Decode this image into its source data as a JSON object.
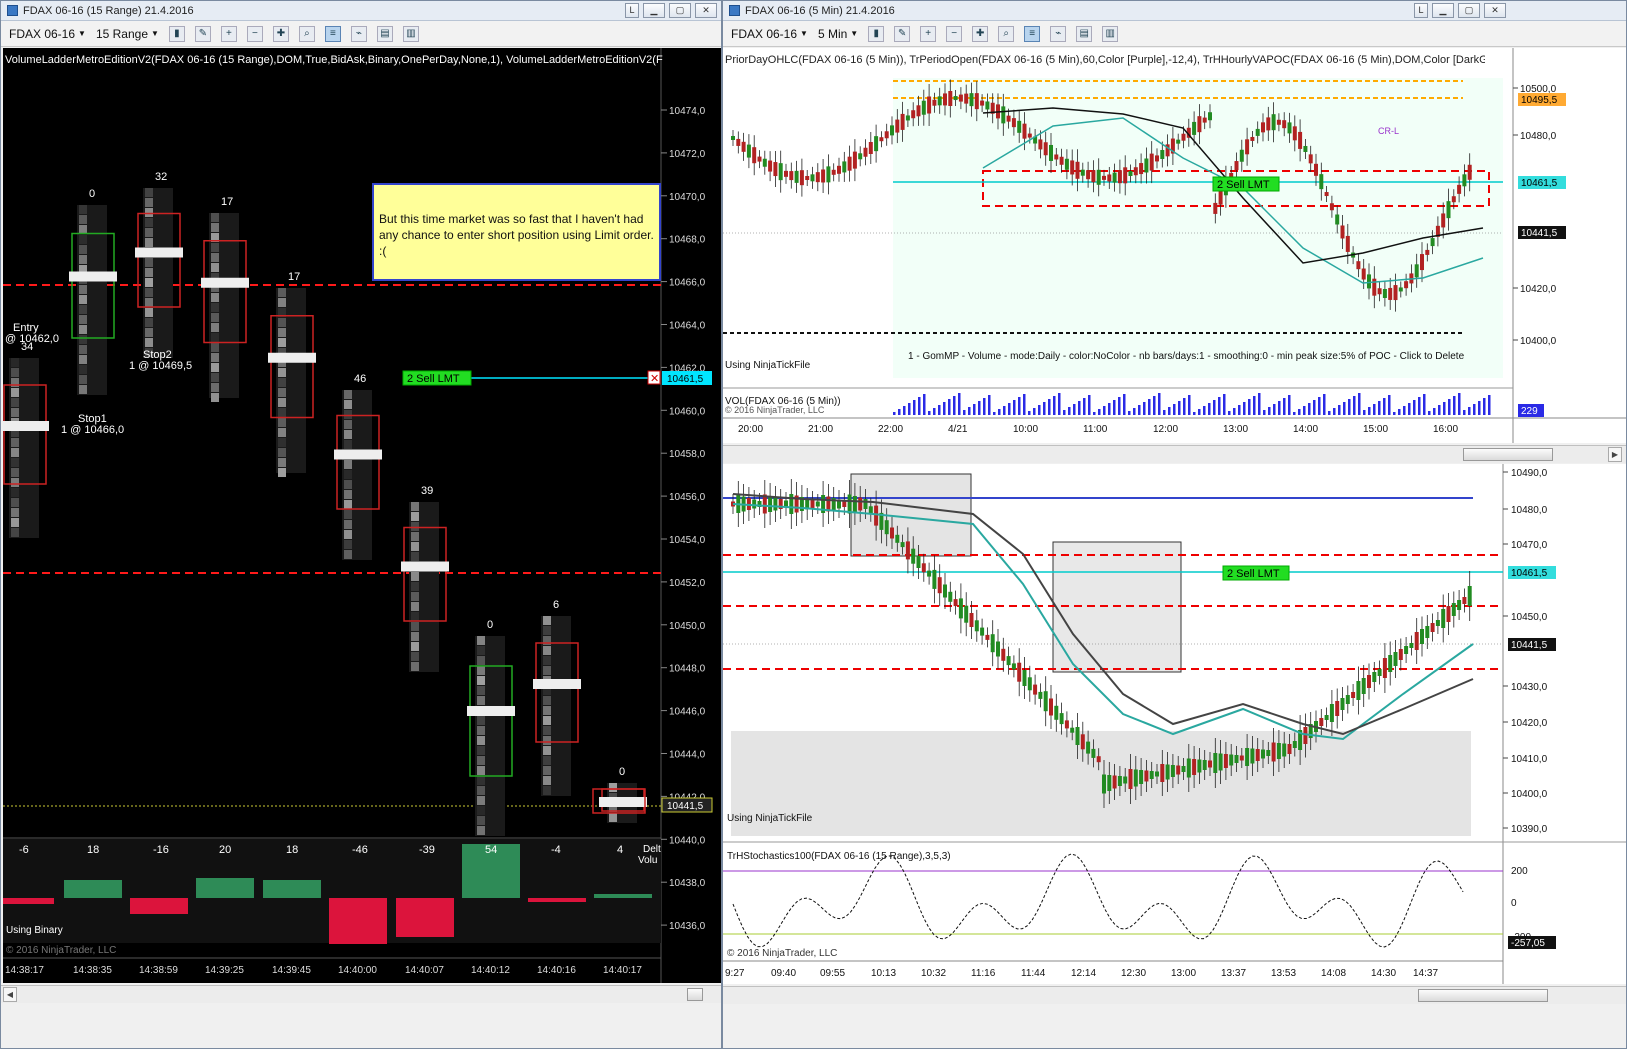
{
  "left_window": {
    "title": "FDAX 06-16 (15 Range)  21.4.2016",
    "instrument": "FDAX 06-16",
    "period": "15 Range",
    "indicator_label": "VolumeLadderMetroEditionV2(FDAX 06-16 (15 Range),DOM,True,BidAsk,Binary,OnePerDay,None,1), VolumeLadderMetroEditionV2(F",
    "note": "But this time market was so fast that I haven't had any chance to enter short position using Limit order. :(",
    "price_axis": [
      "10474,0",
      "10472,0",
      "10470,0",
      "10468,0",
      "10466,0",
      "10464,0",
      "10462,0",
      "10460,0",
      "10458,0",
      "10456,0",
      "10454,0",
      "10452,0",
      "10450,0",
      "10448,0",
      "10446,0",
      "10444,0",
      "10442,0",
      "10440,0",
      "10438,0",
      "10436,0"
    ],
    "price_marker": "10461,5",
    "last_price": "10441,5",
    "order_label": "2  Sell LMT",
    "entry_label": "Entry",
    "entry_price": "@ 10462,0",
    "stop1_label": "Stop1",
    "stop1_price": "1 @ 10466,0",
    "stop2_label": "Stop2",
    "stop2_price": "1 @ 10469,5",
    "bar_totals_top": [
      "34",
      "0",
      "32",
      "17",
      "17",
      "46",
      "39",
      "0",
      "6",
      "0"
    ],
    "delta_values": [
      "-6",
      "18",
      "-16",
      "20",
      "18",
      "-46",
      "-39",
      "54",
      "-4",
      "4"
    ],
    "delta_caption": "Delt\nVolu",
    "using_binary": "Using Binary",
    "copyright": "© 2016 NinjaTrader, LLC",
    "time_axis": [
      "14:38:17",
      "14:38:35",
      "14:38:59",
      "14:39:25",
      "14:39:45",
      "14:40:00",
      "14:40:07",
      "14:40:12",
      "14:40:16",
      "14:40:17"
    ],
    "colors": {
      "bg": "#000000",
      "dash": "#ff1a1a",
      "buy": "#2e8b57",
      "sell": "#dc143c",
      "cyan": "#00e5ff"
    }
  },
  "right_window": {
    "title": "FDAX 06-16 (5 Min)  21.4.2016",
    "instrument": "FDAX 06-16",
    "period": "5 Min",
    "upper_label": "PriorDayOHLC(FDAX 06-16 (5 Min)), TrPeriodOpen(FDAX 06-16 (5 Min),60,Color [Purple],-12,4), TrHHourlyVAPOC(FDAX 06-16 (5 Min),DOM,Color [DarkGray],",
    "upper_axis": [
      "10500,0",
      "10480,0",
      "10420,0",
      "10400,0"
    ],
    "upper_markers": {
      "a": "10495,5",
      "b": "10461,5",
      "c": "10441,5"
    },
    "cr_label": "CR-L",
    "order_label": "2  Sell LMT",
    "using_tick": "Using NinjaTickFile",
    "gom_label": "1 - GomMP - Volume - mode:Daily - color:NoColor - nb bars/days:1 - smoothing:0 - min peak size:5% of POC - Click to Delete",
    "vol_label": "VOL(FDAX 06-16 (5 Min))",
    "vol_value": "229",
    "upper_time_axis": [
      "20:00",
      "21:00",
      "22:00",
      "4/21",
      "10:00",
      "11:00",
      "12:00",
      "13:00",
      "14:00",
      "15:00",
      "16:00"
    ],
    "lower_axis": [
      "10490,0",
      "10480,0",
      "10470,0",
      "10450,0",
      "10430,0",
      "10420,0",
      "10410,0",
      "10400,0",
      "10390,0"
    ],
    "lower_markers": {
      "a": "10461,5",
      "b": "10441,5"
    },
    "lower_using_tick": "Using NinjaTickFile",
    "stoch_label": "TrHStochastics100(FDAX 06-16 (15 Range),3,5,3)",
    "stoch_axis": [
      "200",
      "0",
      "-200"
    ],
    "stoch_value": "-257,05",
    "copyright": "© 2016 NinjaTrader, LLC",
    "lower_time_axis": [
      "9:27",
      "09:40",
      "09:55",
      "10:13",
      "10:32",
      "11:16",
      "11:44",
      "12:14",
      "12:30",
      "13:00",
      "13:37",
      "13:53",
      "14:08",
      "14:30",
      "14:37"
    ]
  }
}
